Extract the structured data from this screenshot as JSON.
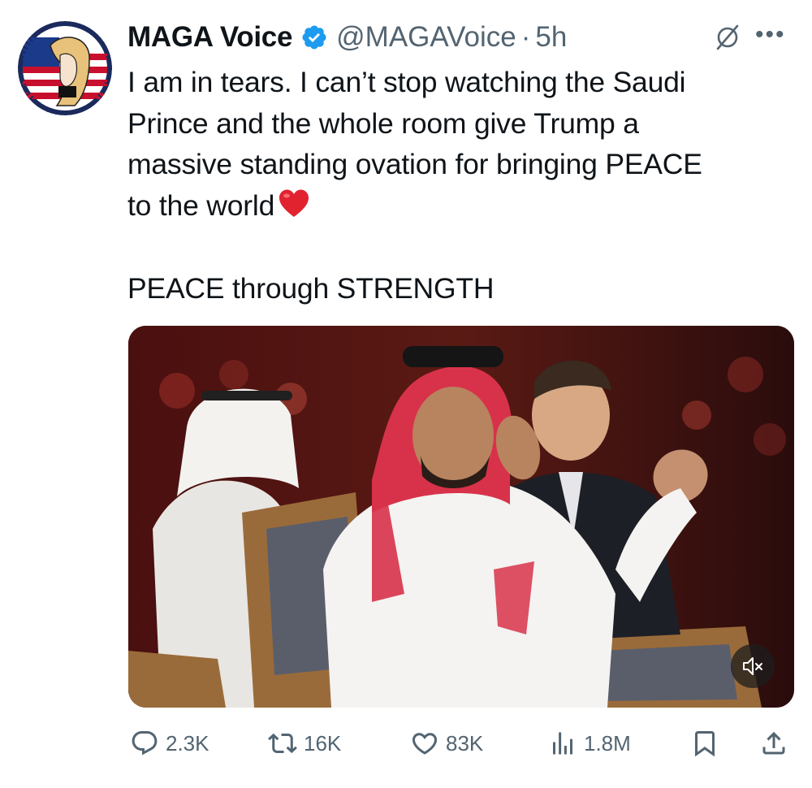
{
  "author": {
    "display_name": "MAGA Voice",
    "handle": "@MAGAVoice",
    "separator": "·",
    "time": "5h",
    "verified": true,
    "avatar_icon": "avatar-flag-portrait"
  },
  "tweet": {
    "lines": [
      "I am in tears. I can’t stop watching the Saudi",
      "Prince and the whole room give Trump a",
      "massive standing ovation for bringing PEACE",
      "to the world"
    ],
    "emoji": "red-heart",
    "tagline": "PEACE through STRENGTH"
  },
  "media": {
    "type": "video",
    "muted": true,
    "mute_icon": "speaker-muted-icon"
  },
  "actions": {
    "replies": "2.3K",
    "reposts": "16K",
    "likes": "83K",
    "views": "1.8M"
  },
  "colors": {
    "text": "#0f1419",
    "secondary": "#536471",
    "verified_blue": "#1d9bf0",
    "heart_red": "#e0245e"
  }
}
